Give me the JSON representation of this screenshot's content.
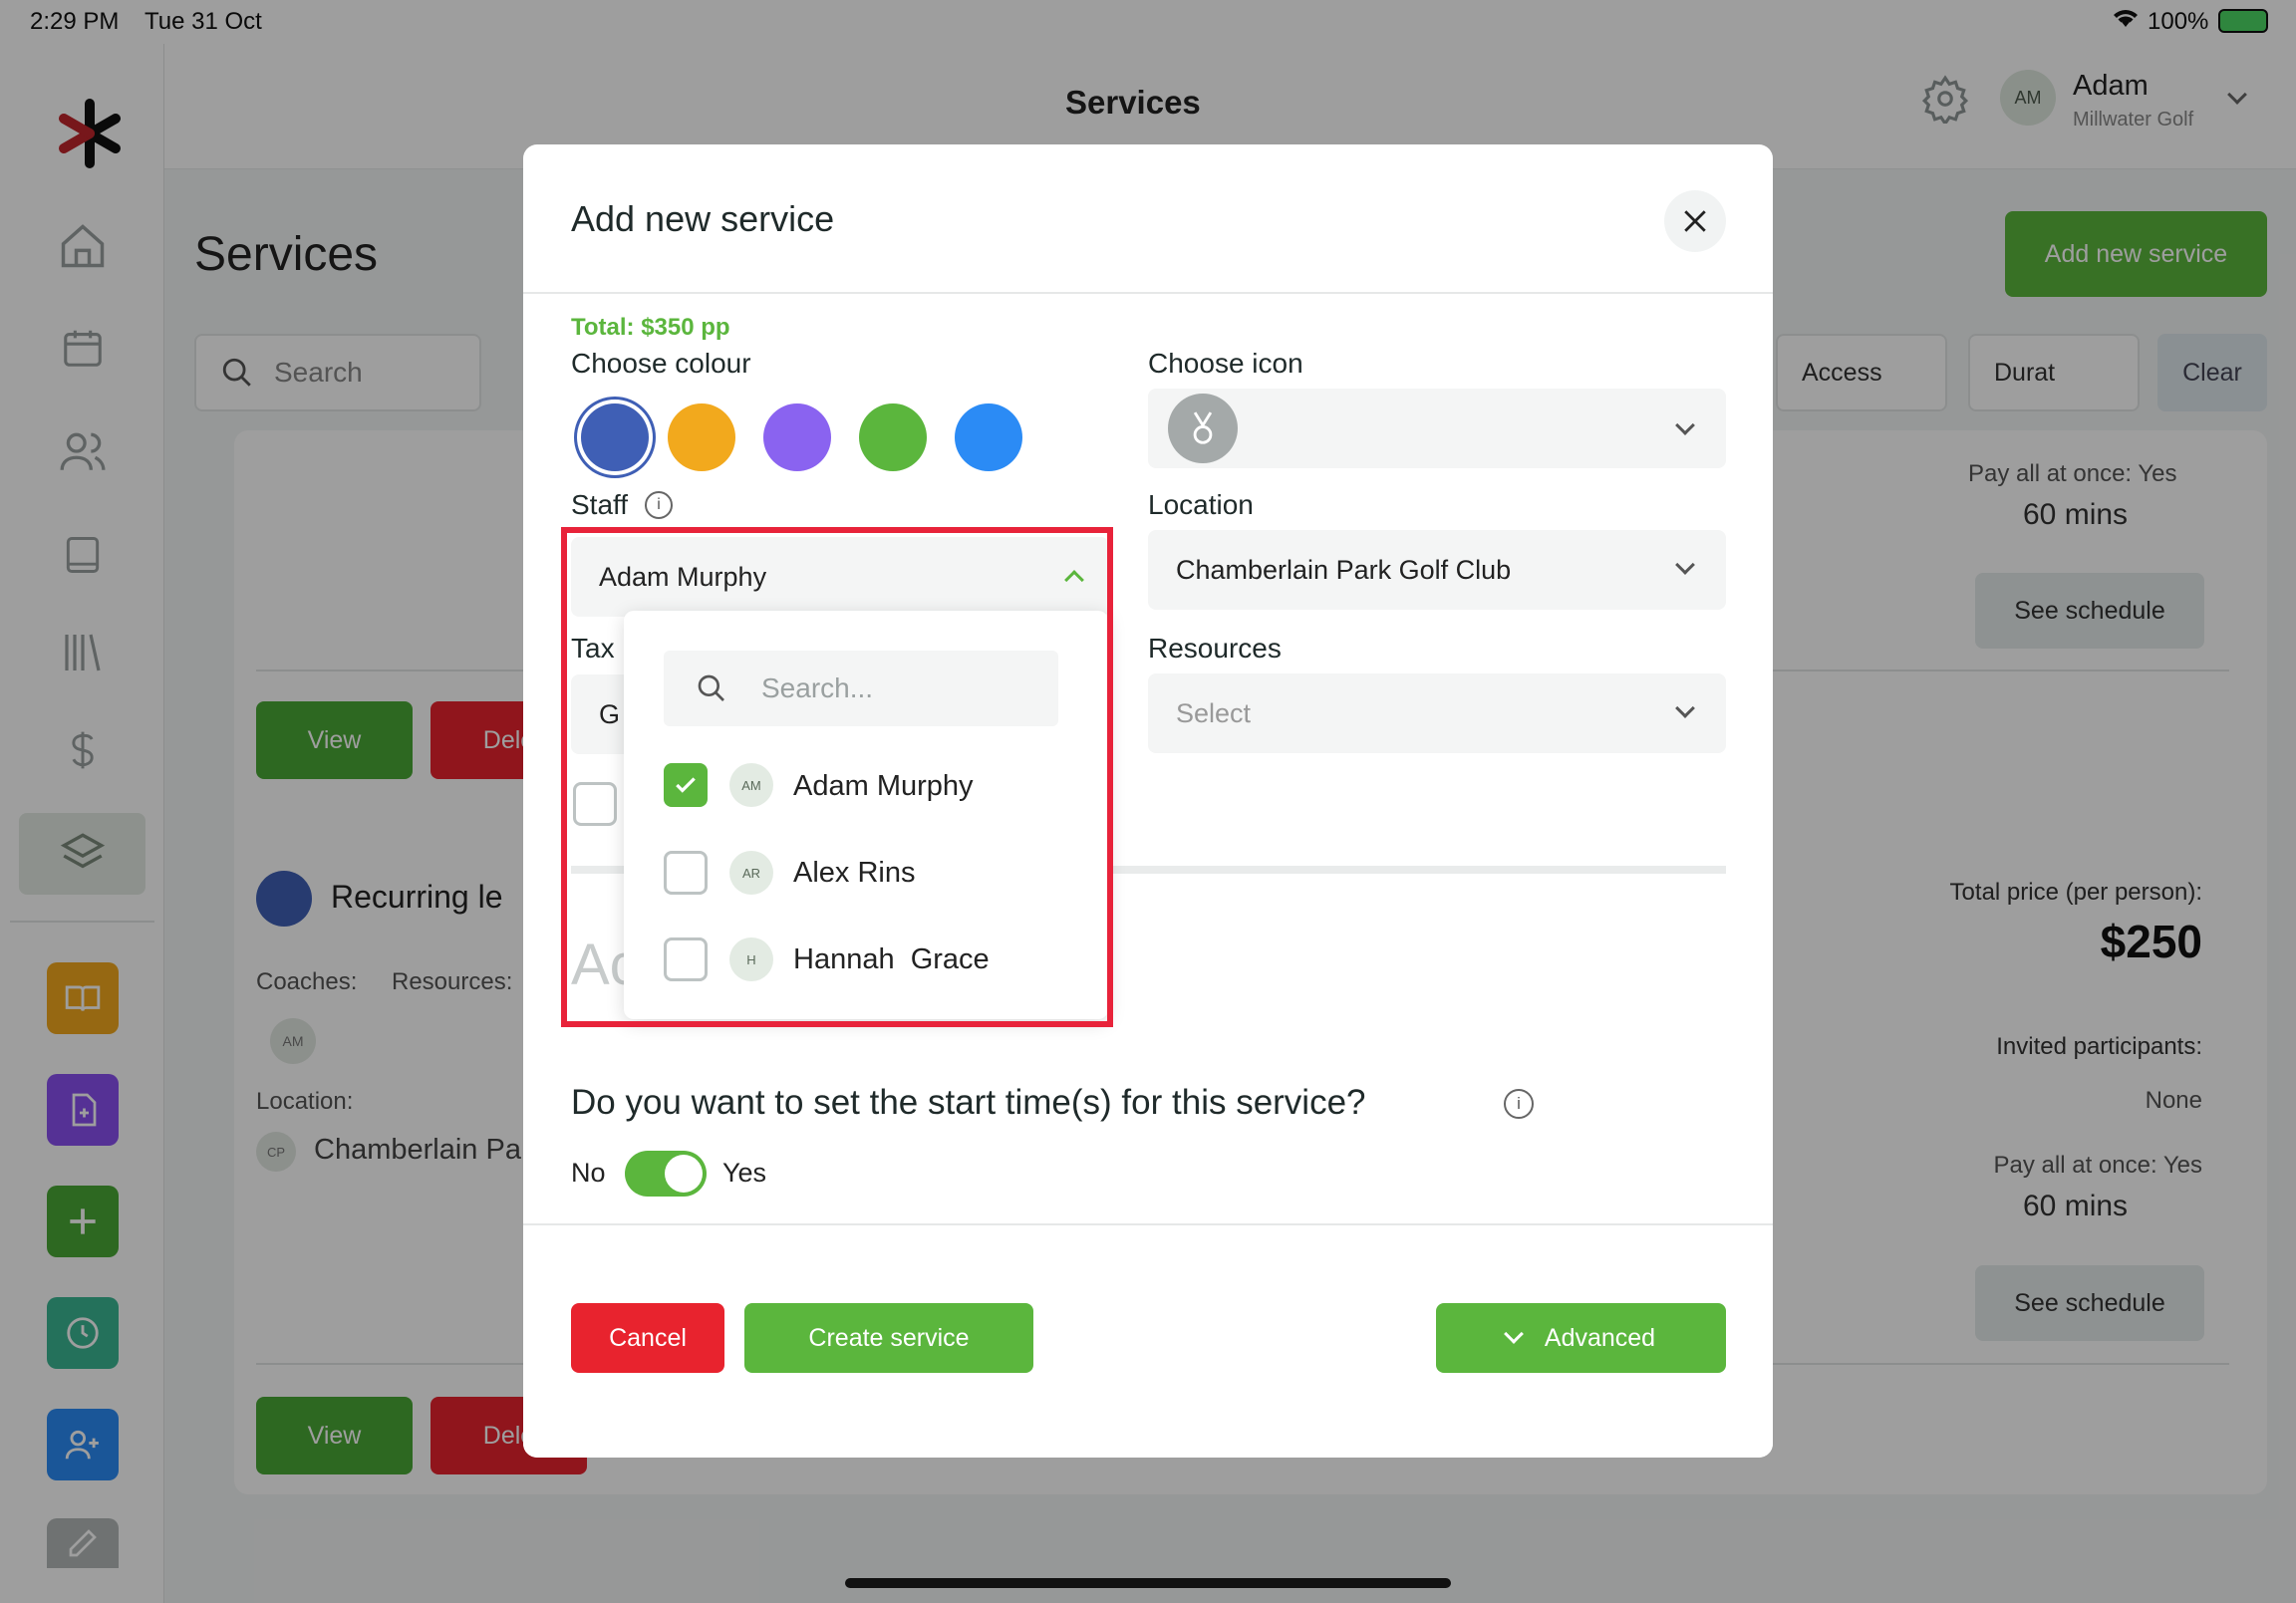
{
  "status_bar": {
    "time": "2:29 PM",
    "date": "Tue 31 Oct",
    "battery": "100%"
  },
  "header": {
    "title": "Services",
    "user_initials": "AM",
    "user_name": "Adam",
    "user_org": "Millwater Golf"
  },
  "page": {
    "title": "Services",
    "add_button": "Add new service",
    "search_placeholder": "Search",
    "filters": {
      "access": "Access",
      "duration": "Durat",
      "clear": "Clear"
    }
  },
  "cards": [
    {
      "pay_all": "Pay all at once: Yes",
      "duration": "60 mins",
      "see_schedule": "See schedule",
      "view": "View",
      "delete": "Dele"
    },
    {
      "title": "Recurring le",
      "coaches_label": "Coaches:",
      "resources_label": "Resources:",
      "coach_initials": "AM",
      "location_label": "Location:",
      "location_initials": "CP",
      "location": "Chamberlain Pa",
      "total_price_label": "Total price (per person):",
      "total_price": "$250",
      "invited_label": "Invited participants:",
      "invited_value": "None",
      "pay_all": "Pay all at once: Yes",
      "duration": "60 mins",
      "see_schedule": "See schedule",
      "view": "View",
      "delete": "Dele"
    }
  ],
  "modal": {
    "title": "Add new service",
    "total": "Total: $350 pp",
    "choose_colour": "Choose colour",
    "colours": [
      "#3f5fb5",
      "#f2a91d",
      "#8a63f0",
      "#5bb63d",
      "#2b8bf5"
    ],
    "choose_icon": "Choose icon",
    "staff_label": "Staff",
    "staff_value": "Adam Murphy",
    "location_label": "Location",
    "location_value": "Chamberlain Park Golf Club",
    "resources_label": "Resources",
    "resources_placeholder": "Select",
    "tax_label": "Tax",
    "tax_value_partial": "G",
    "hidden_heading_partial": "Ac",
    "dropdown": {
      "search_placeholder": "Search...",
      "options": [
        {
          "initials": "AM",
          "name": "Adam Murphy",
          "checked": true
        },
        {
          "initials": "AR",
          "name": "Alex Rins",
          "checked": false
        },
        {
          "initials": "H",
          "name": "Hannah  Grace",
          "checked": false
        }
      ]
    },
    "start_time_question": "Do you want to set the start time(s) for this service?",
    "toggle_no": "No",
    "toggle_yes": "Yes",
    "toggle_on": true,
    "cancel": "Cancel",
    "create": "Create service",
    "advanced": "Advanced"
  },
  "colors": {
    "green": "#5bb63d",
    "red": "#e8232e",
    "highlight": "#e8233a"
  }
}
